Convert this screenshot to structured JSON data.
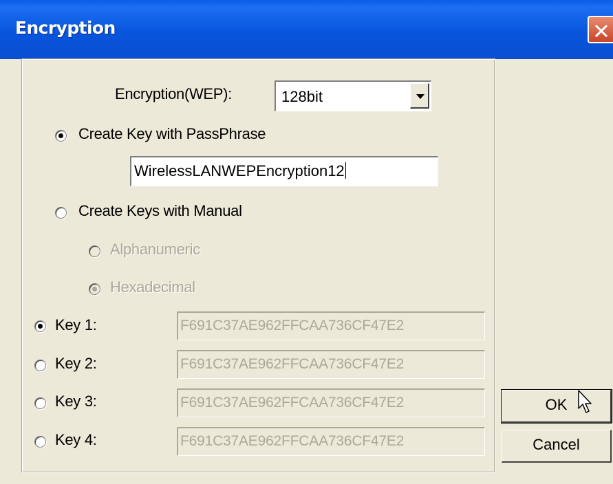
{
  "window": {
    "title": "Encryption"
  },
  "encryption": {
    "label": "Encryption(WEP):",
    "selected": "128bit"
  },
  "passphrase_option": {
    "label": "Create Key with PassPhrase",
    "checked": true,
    "value": "WirelessLANWEPEncryption12"
  },
  "manual_option": {
    "label": "Create Keys with Manual",
    "checked": false
  },
  "format": {
    "alphanumeric": {
      "label": "Alphanumeric",
      "checked": false,
      "disabled": true
    },
    "hexadecimal": {
      "label": "Hexadecimal",
      "checked": true,
      "disabled": true
    }
  },
  "keys": [
    {
      "label": "Key 1:",
      "value": "F691C37AE962FFCAA736CF47E2",
      "checked": true
    },
    {
      "label": "Key 2:",
      "value": "F691C37AE962FFCAA736CF47E2",
      "checked": false
    },
    {
      "label": "Key 3:",
      "value": "F691C37AE962FFCAA736CF47E2",
      "checked": false
    },
    {
      "label": "Key 4:",
      "value": "F691C37AE962FFCAA736CF47E2",
      "checked": false
    }
  ],
  "buttons": {
    "ok": "OK",
    "cancel": "Cancel"
  },
  "icons": {
    "close": "close-icon",
    "dropdown": "chevron-down-icon",
    "cursor": "mouse-pointer-icon"
  }
}
